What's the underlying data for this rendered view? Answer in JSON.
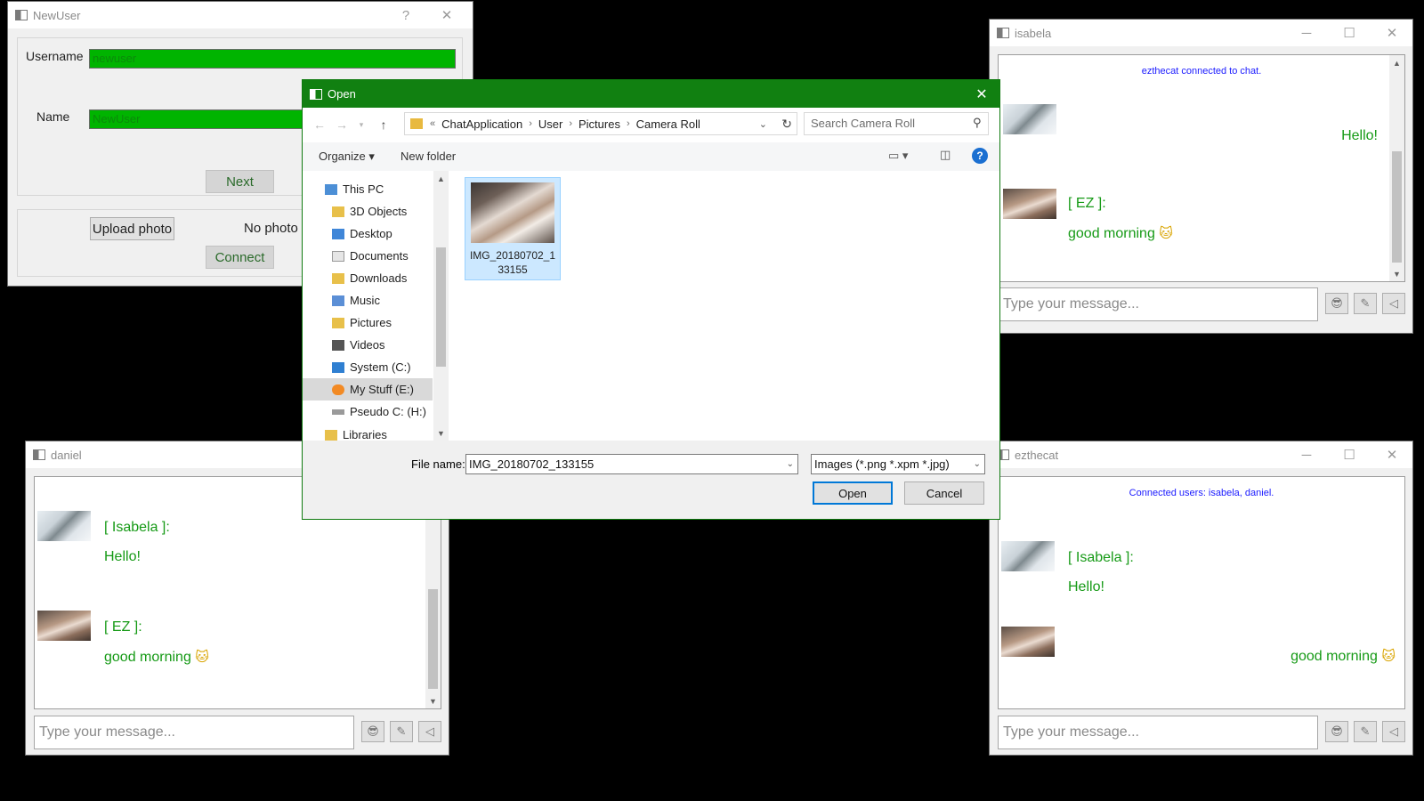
{
  "newuser_window": {
    "title": "NewUser",
    "help_glyph": "?",
    "close_glyph": "✕",
    "username_label": "Username",
    "username_value": "newuser",
    "name_label": "Name",
    "name_value": "NewUser",
    "next_label": "Next",
    "upload_label": "Upload photo",
    "no_photo_text": "No photo",
    "connect_label": "Connect",
    "field_color": "#00b400"
  },
  "isabela_window": {
    "title": "isabela",
    "status": "ezthecat connected to chat.",
    "message_right": "Hello!",
    "name_ez": "[ EZ ]:",
    "msg_ez": "good morning",
    "input_placeholder": "Type your message..."
  },
  "daniel_window": {
    "title": "daniel",
    "name_isabela": "[ Isabela ]:",
    "msg_isabela": "Hello!",
    "name_ez": "[ EZ ]:",
    "msg_ez": "good morning",
    "input_placeholder": "Type your message..."
  },
  "ezthecat_window": {
    "title": "ezthecat",
    "status": "Connected users: isabela, daniel.",
    "name_isabela": "[ Isabela ]:",
    "msg_isabela": "Hello!",
    "msg_right": "good morning",
    "input_placeholder": "Type your message..."
  },
  "chat_buttons": {
    "emoji_icon": "😎",
    "attach_icon": "paperclip-icon",
    "send_icon": "send-icon"
  },
  "cat_emoji": "🐱",
  "open_dialog": {
    "title": "Open",
    "breadcrumb": [
      "«",
      "ChatApplication",
      "User",
      "Pictures",
      "Camera Roll"
    ],
    "search_placeholder": "Search Camera Roll",
    "organize_label": "Organize ▾",
    "new_folder_label": "New folder",
    "nav_items": [
      {
        "label": "This PC",
        "icon": "pc-icon"
      },
      {
        "label": "3D Objects",
        "icon": "folder-icon"
      },
      {
        "label": "Desktop",
        "icon": "desktop-icon"
      },
      {
        "label": "Documents",
        "icon": "documents-icon"
      },
      {
        "label": "Downloads",
        "icon": "downloads-icon"
      },
      {
        "label": "Music",
        "icon": "music-icon"
      },
      {
        "label": "Pictures",
        "icon": "pictures-icon"
      },
      {
        "label": "Videos",
        "icon": "videos-icon"
      },
      {
        "label": "System (C:)",
        "icon": "drive-icon"
      },
      {
        "label": "My Stuff (E:)",
        "icon": "drive-icon"
      },
      {
        "label": "Pseudo C: (H:)",
        "icon": "drive-icon"
      },
      {
        "label": "Libraries",
        "icon": "library-icon"
      }
    ],
    "selected_nav": "My Stuff (E:)",
    "file_label": "IMG_20180702_133155",
    "file_name_label": "File name:",
    "file_name_value": "IMG_20180702_133155",
    "file_type_value": "Images (*.png *.xpm *.jpg)",
    "open_label": "Open",
    "cancel_label": "Cancel",
    "accent_color": "#118011"
  }
}
